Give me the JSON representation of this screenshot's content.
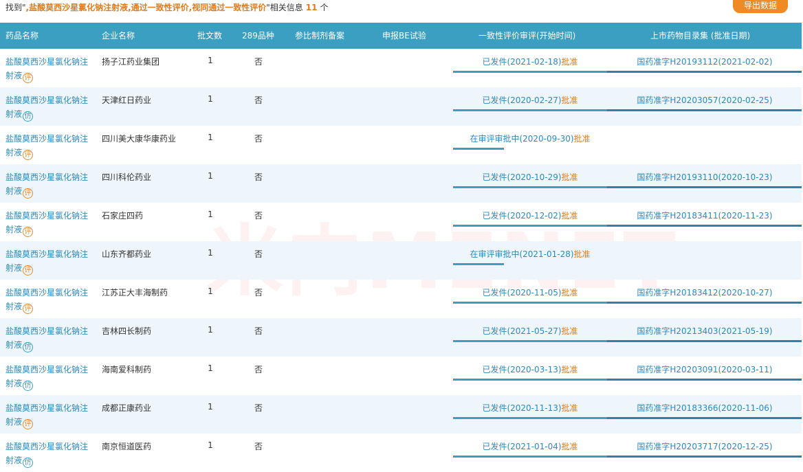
{
  "summary": {
    "prefix": "找到\"",
    "keyword": ",盐酸莫西沙星氯化钠注射液,通过一致性评价,视同通过一致性评价",
    "suffix": "\"相关信息",
    "count": "11",
    "unit": "个"
  },
  "export_label": "导出数据",
  "watermark": "米内MENET",
  "headers": {
    "drug": "药品名称",
    "company": "企业名称",
    "batch": "批文数",
    "v289": "289品种",
    "ref_record": "参比制剂备案",
    "be_trial": "申报BE试验",
    "review": "一致性评价审评(开始时间)",
    "listing": "上市药物目录集 (批准日期)"
  },
  "badges": {
    "ping": "评",
    "fang": "仿"
  },
  "colors": {
    "header_bg": "#3a9fc1",
    "accent_orange": "#e07b1b",
    "link_blue": "#2e88b9"
  },
  "rows": [
    {
      "drug": "盐酸莫西沙星氯化钠注射液",
      "badge": "ping",
      "company": "扬子江药业集团",
      "batch": "1",
      "v289": "否",
      "review_status": "已发件(2021-02-18)",
      "review_result": "批准",
      "listing": "国药准字H20193112(2021-02-02)"
    },
    {
      "drug": "盐酸莫西沙星氯化钠注射液",
      "badge": "fang",
      "company": "天津红日药业",
      "batch": "1",
      "v289": "否",
      "review_status": "已发件(2020-02-27)",
      "review_result": "批准",
      "listing": "国药准字H20203057(2020-02-25)"
    },
    {
      "drug": "盐酸莫西沙星氯化钠注射液",
      "badge": "ping",
      "company": "四川美大康华康药业",
      "batch": "1",
      "v289": "否",
      "review_status": "在审评审批中(2020-09-30)",
      "review_result": "批准",
      "listing": ""
    },
    {
      "drug": "盐酸莫西沙星氯化钠注射液",
      "badge": "ping",
      "company": "四川科伦药业",
      "batch": "1",
      "v289": "否",
      "review_status": "已发件(2020-10-29)",
      "review_result": "批准",
      "listing": "国药准字H20193110(2020-10-23)"
    },
    {
      "drug": "盐酸莫西沙星氯化钠注射液",
      "badge": "ping",
      "company": "石家庄四药",
      "batch": "1",
      "v289": "否",
      "review_status": "已发件(2020-12-02)",
      "review_result": "批准",
      "listing": "国药准字H20183411(2020-11-23)"
    },
    {
      "drug": "盐酸莫西沙星氯化钠注射液",
      "badge": "ping",
      "company": "山东齐都药业",
      "batch": "1",
      "v289": "否",
      "review_status": "在审评审批中(2021-01-28)",
      "review_result": "批准",
      "listing": ""
    },
    {
      "drug": "盐酸莫西沙星氯化钠注射液",
      "badge": "ping",
      "company": "江苏正大丰海制药",
      "batch": "1",
      "v289": "否",
      "review_status": "已发件(2020-11-05)",
      "review_result": "批准",
      "listing": "国药准字H20183412(2020-10-27)"
    },
    {
      "drug": "盐酸莫西沙星氯化钠注射液",
      "badge": "fang",
      "company": "吉林四长制药",
      "batch": "1",
      "v289": "否",
      "review_status": "已发件(2021-05-27)",
      "review_result": "批准",
      "listing": "国药准字H20213403(2021-05-19)"
    },
    {
      "drug": "盐酸莫西沙星氯化钠注射液",
      "badge": "fang",
      "company": "海南爱科制药",
      "batch": "1",
      "v289": "否",
      "review_status": "已发件(2020-03-13)",
      "review_result": "批准",
      "listing": "国药准字H20203091(2020-03-11)"
    },
    {
      "drug": "盐酸莫西沙星氯化钠注射液",
      "badge": "ping",
      "company": "成都正康药业",
      "batch": "1",
      "v289": "否",
      "review_status": "已发件(2020-11-13)",
      "review_result": "批准",
      "listing": "国药准字H20183366(2020-11-06)"
    },
    {
      "drug": "盐酸莫西沙星氯化钠注射液",
      "badge": "fang",
      "company": "南京恒道医药",
      "batch": "1",
      "v289": "否",
      "review_status": "已发件(2021-01-04)",
      "review_result": "批准",
      "listing": "国药准字H20203717(2020-12-25)"
    }
  ]
}
